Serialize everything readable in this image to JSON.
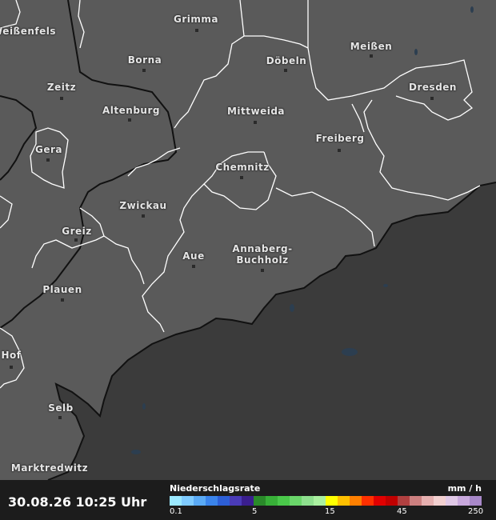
{
  "map": {
    "cities": [
      {
        "name": "Grimma",
        "id": "grimma"
      },
      {
        "name": "Weißenfels",
        "id": "weissenfels"
      },
      {
        "name": "Borna",
        "id": "borna"
      },
      {
        "name": "Döbeln",
        "id": "doebeln"
      },
      {
        "name": "Meißen",
        "id": "meissen"
      },
      {
        "name": "Zeitz",
        "id": "zeitz"
      },
      {
        "name": "Dresden",
        "id": "dresden"
      },
      {
        "name": "Altenburg",
        "id": "altenburg"
      },
      {
        "name": "Mittweida",
        "id": "mittweida"
      },
      {
        "name": "Gera",
        "id": "gera"
      },
      {
        "name": "Freiberg",
        "id": "freiberg"
      },
      {
        "name": "Chemnitz",
        "id": "chemnitz"
      },
      {
        "name": "Zwickau",
        "id": "zwickau"
      },
      {
        "name": "Greiz",
        "id": "greiz"
      },
      {
        "name": "Annaberg-\nBuchholz",
        "id": "annaberg"
      },
      {
        "name": "Aue",
        "id": "aue"
      },
      {
        "name": "Plauen",
        "id": "plauen"
      },
      {
        "name": "Hof",
        "id": "hof"
      },
      {
        "name": "Selb",
        "id": "selb"
      },
      {
        "name": "Marktredwitz",
        "id": "marktredwitz"
      }
    ],
    "colors": {
      "land": "#5a5a5a",
      "outside": "#3b3b3b",
      "border_state": "#ffffff",
      "border_country": "#111111",
      "water": "#2c3e50"
    }
  },
  "footer": {
    "timestamp": "30.08.26 10:25 Uhr",
    "legend_title": "Niederschlagsrate",
    "legend_unit": "mm / h",
    "legend_ticks": [
      "0.1",
      "5",
      "15",
      "45",
      "250"
    ],
    "legend_colors": [
      "#9be8ff",
      "#7fcbff",
      "#5aaaf5",
      "#3a84eb",
      "#2d5fd6",
      "#4a3bb8",
      "#3a1e8e",
      "#2a8a2a",
      "#38b038",
      "#4ac84a",
      "#6ad66a",
      "#8ee08e",
      "#aaf0a0",
      "#ffff00",
      "#ffc000",
      "#ff8000",
      "#ff3000",
      "#e00000",
      "#c00000",
      "#b04040",
      "#cc8080",
      "#e6b0b0",
      "#f2d0d0",
      "#e0c8e6",
      "#c8a8dc",
      "#a888c8"
    ]
  }
}
